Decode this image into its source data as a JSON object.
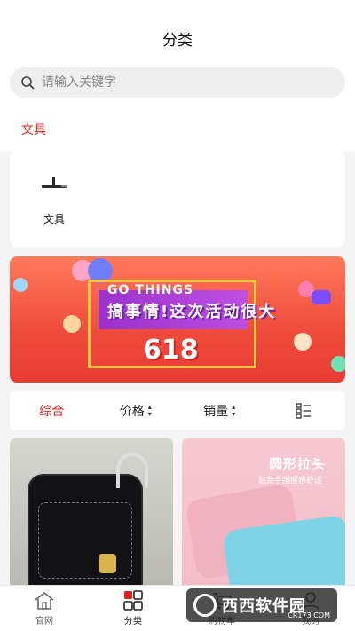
{
  "header": {
    "title": "分类"
  },
  "search": {
    "placeholder": "请输入关键字"
  },
  "tabs": [
    {
      "label": "文具",
      "active": true
    }
  ],
  "category_items": [
    {
      "label": "文具",
      "icon": "pen-icon"
    }
  ],
  "banner": {
    "line1": "GO THINGS",
    "slogan": "搞事情!这次活动很大",
    "number": "618"
  },
  "sort": {
    "items": [
      {
        "label": "综合",
        "active": true
      },
      {
        "label": "价格",
        "caret": true
      },
      {
        "label": "销量",
        "caret": true
      }
    ],
    "layout_icon": "grid-list-icon"
  },
  "products": [
    {
      "image": "black-randoseru-backpack"
    },
    {
      "image": "pink-blue-pencil-case",
      "overlay_title": "圆形拉头",
      "overlay_sub": "贴合手指握感舒适"
    }
  ],
  "tabbar": {
    "items": [
      {
        "label": "官网",
        "icon": "home-icon",
        "active": false
      },
      {
        "label": "分类",
        "icon": "category-grid-icon",
        "active": true
      },
      {
        "label": "购物车",
        "icon": "cart-icon",
        "active": false
      },
      {
        "label": "我的",
        "icon": "user-icon",
        "active": false
      }
    ]
  },
  "watermark": {
    "text": "西西软件园",
    "sub": "CR173.COM"
  },
  "colors": {
    "accent": "#e2231a",
    "background": "#f4f4f4"
  }
}
